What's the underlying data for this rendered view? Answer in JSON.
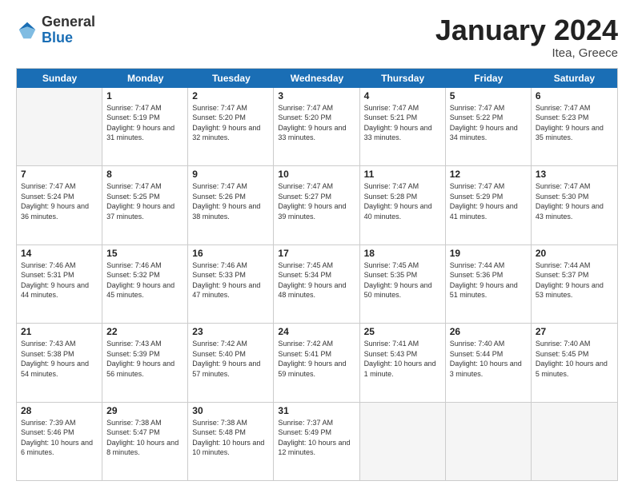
{
  "logo": {
    "general": "General",
    "blue": "Blue"
  },
  "header": {
    "title": "January 2024",
    "location": "Itea, Greece"
  },
  "weekdays": [
    "Sunday",
    "Monday",
    "Tuesday",
    "Wednesday",
    "Thursday",
    "Friday",
    "Saturday"
  ],
  "weeks": [
    [
      {
        "day": "",
        "empty": true
      },
      {
        "day": "1",
        "sunrise": "Sunrise: 7:47 AM",
        "sunset": "Sunset: 5:19 PM",
        "daylight": "Daylight: 9 hours and 31 minutes."
      },
      {
        "day": "2",
        "sunrise": "Sunrise: 7:47 AM",
        "sunset": "Sunset: 5:20 PM",
        "daylight": "Daylight: 9 hours and 32 minutes."
      },
      {
        "day": "3",
        "sunrise": "Sunrise: 7:47 AM",
        "sunset": "Sunset: 5:20 PM",
        "daylight": "Daylight: 9 hours and 33 minutes."
      },
      {
        "day": "4",
        "sunrise": "Sunrise: 7:47 AM",
        "sunset": "Sunset: 5:21 PM",
        "daylight": "Daylight: 9 hours and 33 minutes."
      },
      {
        "day": "5",
        "sunrise": "Sunrise: 7:47 AM",
        "sunset": "Sunset: 5:22 PM",
        "daylight": "Daylight: 9 hours and 34 minutes."
      },
      {
        "day": "6",
        "sunrise": "Sunrise: 7:47 AM",
        "sunset": "Sunset: 5:23 PM",
        "daylight": "Daylight: 9 hours and 35 minutes."
      }
    ],
    [
      {
        "day": "7",
        "sunrise": "Sunrise: 7:47 AM",
        "sunset": "Sunset: 5:24 PM",
        "daylight": "Daylight: 9 hours and 36 minutes."
      },
      {
        "day": "8",
        "sunrise": "Sunrise: 7:47 AM",
        "sunset": "Sunset: 5:25 PM",
        "daylight": "Daylight: 9 hours and 37 minutes."
      },
      {
        "day": "9",
        "sunrise": "Sunrise: 7:47 AM",
        "sunset": "Sunset: 5:26 PM",
        "daylight": "Daylight: 9 hours and 38 minutes."
      },
      {
        "day": "10",
        "sunrise": "Sunrise: 7:47 AM",
        "sunset": "Sunset: 5:27 PM",
        "daylight": "Daylight: 9 hours and 39 minutes."
      },
      {
        "day": "11",
        "sunrise": "Sunrise: 7:47 AM",
        "sunset": "Sunset: 5:28 PM",
        "daylight": "Daylight: 9 hours and 40 minutes."
      },
      {
        "day": "12",
        "sunrise": "Sunrise: 7:47 AM",
        "sunset": "Sunset: 5:29 PM",
        "daylight": "Daylight: 9 hours and 41 minutes."
      },
      {
        "day": "13",
        "sunrise": "Sunrise: 7:47 AM",
        "sunset": "Sunset: 5:30 PM",
        "daylight": "Daylight: 9 hours and 43 minutes."
      }
    ],
    [
      {
        "day": "14",
        "sunrise": "Sunrise: 7:46 AM",
        "sunset": "Sunset: 5:31 PM",
        "daylight": "Daylight: 9 hours and 44 minutes."
      },
      {
        "day": "15",
        "sunrise": "Sunrise: 7:46 AM",
        "sunset": "Sunset: 5:32 PM",
        "daylight": "Daylight: 9 hours and 45 minutes."
      },
      {
        "day": "16",
        "sunrise": "Sunrise: 7:46 AM",
        "sunset": "Sunset: 5:33 PM",
        "daylight": "Daylight: 9 hours and 47 minutes."
      },
      {
        "day": "17",
        "sunrise": "Sunrise: 7:45 AM",
        "sunset": "Sunset: 5:34 PM",
        "daylight": "Daylight: 9 hours and 48 minutes."
      },
      {
        "day": "18",
        "sunrise": "Sunrise: 7:45 AM",
        "sunset": "Sunset: 5:35 PM",
        "daylight": "Daylight: 9 hours and 50 minutes."
      },
      {
        "day": "19",
        "sunrise": "Sunrise: 7:44 AM",
        "sunset": "Sunset: 5:36 PM",
        "daylight": "Daylight: 9 hours and 51 minutes."
      },
      {
        "day": "20",
        "sunrise": "Sunrise: 7:44 AM",
        "sunset": "Sunset: 5:37 PM",
        "daylight": "Daylight: 9 hours and 53 minutes."
      }
    ],
    [
      {
        "day": "21",
        "sunrise": "Sunrise: 7:43 AM",
        "sunset": "Sunset: 5:38 PM",
        "daylight": "Daylight: 9 hours and 54 minutes."
      },
      {
        "day": "22",
        "sunrise": "Sunrise: 7:43 AM",
        "sunset": "Sunset: 5:39 PM",
        "daylight": "Daylight: 9 hours and 56 minutes."
      },
      {
        "day": "23",
        "sunrise": "Sunrise: 7:42 AM",
        "sunset": "Sunset: 5:40 PM",
        "daylight": "Daylight: 9 hours and 57 minutes."
      },
      {
        "day": "24",
        "sunrise": "Sunrise: 7:42 AM",
        "sunset": "Sunset: 5:41 PM",
        "daylight": "Daylight: 9 hours and 59 minutes."
      },
      {
        "day": "25",
        "sunrise": "Sunrise: 7:41 AM",
        "sunset": "Sunset: 5:43 PM",
        "daylight": "Daylight: 10 hours and 1 minute."
      },
      {
        "day": "26",
        "sunrise": "Sunrise: 7:40 AM",
        "sunset": "Sunset: 5:44 PM",
        "daylight": "Daylight: 10 hours and 3 minutes."
      },
      {
        "day": "27",
        "sunrise": "Sunrise: 7:40 AM",
        "sunset": "Sunset: 5:45 PM",
        "daylight": "Daylight: 10 hours and 5 minutes."
      }
    ],
    [
      {
        "day": "28",
        "sunrise": "Sunrise: 7:39 AM",
        "sunset": "Sunset: 5:46 PM",
        "daylight": "Daylight: 10 hours and 6 minutes."
      },
      {
        "day": "29",
        "sunrise": "Sunrise: 7:38 AM",
        "sunset": "Sunset: 5:47 PM",
        "daylight": "Daylight: 10 hours and 8 minutes."
      },
      {
        "day": "30",
        "sunrise": "Sunrise: 7:38 AM",
        "sunset": "Sunset: 5:48 PM",
        "daylight": "Daylight: 10 hours and 10 minutes."
      },
      {
        "day": "31",
        "sunrise": "Sunrise: 7:37 AM",
        "sunset": "Sunset: 5:49 PM",
        "daylight": "Daylight: 10 hours and 12 minutes."
      },
      {
        "day": "",
        "empty": true
      },
      {
        "day": "",
        "empty": true
      },
      {
        "day": "",
        "empty": true
      }
    ]
  ]
}
